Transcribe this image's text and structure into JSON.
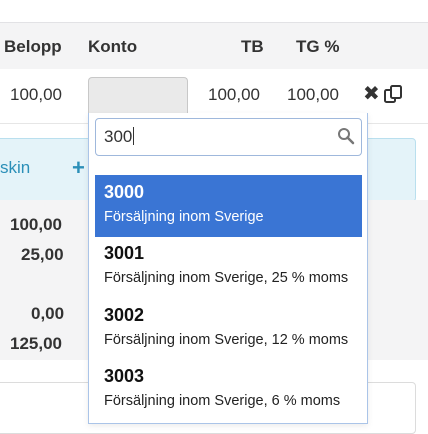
{
  "header": {
    "belopp": "Belopp",
    "konto": "Konto",
    "tb": "TB",
    "tg": "TG %"
  },
  "row": {
    "belopp": "100,00",
    "tb": "100,00",
    "tg": "100,00",
    "delete_icon": "x-icon",
    "copy_icon": "copy-icon"
  },
  "info_band": {
    "text": "skin",
    "plus": "+"
  },
  "sums": [
    "100,00",
    "25,00",
    "0,00",
    "125,00"
  ],
  "search": {
    "value": "300",
    "icon": "search-icon"
  },
  "options": [
    {
      "code": "3000",
      "desc": "Försäljning inom Sverige",
      "selected": true
    },
    {
      "code": "3001",
      "desc": "Försäljning inom Sverige, 25 % moms",
      "selected": false
    },
    {
      "code": "3002",
      "desc": "Försäljning inom Sverige, 12 % moms",
      "selected": false
    },
    {
      "code": "3003",
      "desc": "Försäljning inom Sverige, 6 % moms",
      "selected": false
    }
  ],
  "colors": {
    "selected": "#3a75d4",
    "info_text": "#2b8fb8"
  }
}
